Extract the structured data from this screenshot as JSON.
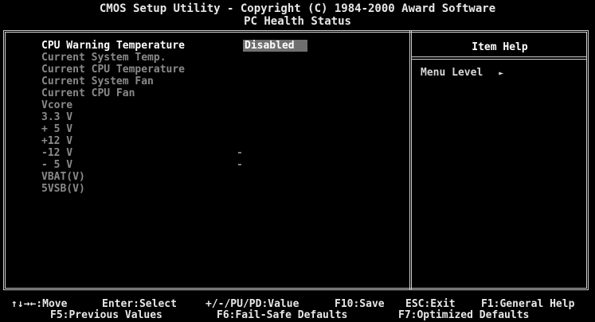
{
  "header": {
    "title": "CMOS Setup Utility - Copyright (C) 1984-2000 Award Software",
    "subtitle": "PC Health Status"
  },
  "items": [
    {
      "label": "CPU Warning Temperature",
      "value": "Disabled"
    },
    {
      "label": "Current System Temp.",
      "value": ""
    },
    {
      "label": "Current CPU Temperature",
      "value": ""
    },
    {
      "label": "Current System Fan",
      "value": ""
    },
    {
      "label": "Current CPU Fan",
      "value": ""
    },
    {
      "label": "Vcore",
      "value": ""
    },
    {
      "label": "3.3 V",
      "value": ""
    },
    {
      "label": "+ 5 V",
      "value": ""
    },
    {
      "label": "+12 V",
      "value": ""
    },
    {
      "label": "-12 V",
      "value": "-"
    },
    {
      "label": "- 5 V",
      "value": "-"
    },
    {
      "label": "VBAT(V)",
      "value": ""
    },
    {
      "label": "5VSB(V)",
      "value": ""
    }
  ],
  "help": {
    "title": "Item Help",
    "menu_level": "Menu Level",
    "arrow_glyph": "►"
  },
  "footer": {
    "row1": {
      "move": "↑↓→←:Move",
      "select": "Enter:Select",
      "value": "+/-/PU/PD:Value",
      "save": "F10:Save",
      "exit": "ESC:Exit",
      "help": "F1:General Help"
    },
    "row2": {
      "prev": "F5:Previous Values",
      "failsafe": "F6:Fail-Safe Defaults",
      "optimized": "F7:Optimized Defaults"
    }
  },
  "colors": {
    "background": "#000000",
    "text": "#ffffff",
    "dimmed": "#8a8a8a",
    "highlight": "#6f6f6f"
  }
}
